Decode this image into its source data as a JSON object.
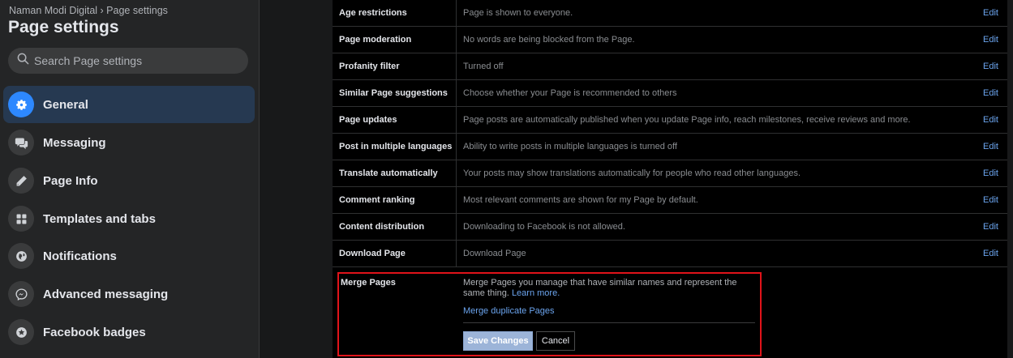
{
  "sidebar": {
    "breadcrumb": "Naman Modi Digital › Page settings",
    "title": "Page settings",
    "search_placeholder": "Search Page settings",
    "items": [
      {
        "label": "General",
        "icon": "gear-icon",
        "active": true
      },
      {
        "label": "Messaging",
        "icon": "chat-bubbles-icon"
      },
      {
        "label": "Page Info",
        "icon": "pencil-icon"
      },
      {
        "label": "Templates and tabs",
        "icon": "grid-icon"
      },
      {
        "label": "Notifications",
        "icon": "globe-icon"
      },
      {
        "label": "Advanced messaging",
        "icon": "messenger-icon"
      },
      {
        "label": "Facebook badges",
        "icon": "star-badge-icon"
      }
    ]
  },
  "settings": {
    "edit_label": "Edit",
    "rows": [
      {
        "label": "Age restrictions",
        "value": "Page is shown to everyone."
      },
      {
        "label": "Page moderation",
        "value": "No words are being blocked from the Page."
      },
      {
        "label": "Profanity filter",
        "value": "Turned off"
      },
      {
        "label": "Similar Page suggestions",
        "value": "Choose whether your Page is recommended to others"
      },
      {
        "label": "Page updates",
        "value": "Page posts are automatically published when you update Page info, reach milestones, receive reviews and more."
      },
      {
        "label": "Post in multiple languages",
        "value": "Ability to write posts in multiple languages is turned off"
      },
      {
        "label": "Translate automatically",
        "value": "Your posts may show translations automatically for people who read other languages."
      },
      {
        "label": "Comment ranking",
        "value": "Most relevant comments are shown for my Page by default."
      },
      {
        "label": "Content distribution",
        "value": "Downloading to Facebook is not allowed."
      },
      {
        "label": "Download Page",
        "value": "Download Page"
      }
    ],
    "merge": {
      "label": "Merge Pages",
      "description": "Merge Pages you manage that have similar names and represent the same thing.",
      "learn_more": "Learn more.",
      "link": "Merge duplicate Pages",
      "save": "Save Changes",
      "cancel": "Cancel"
    }
  },
  "colors": {
    "accent": "#2d88ff",
    "link": "#6ba4ee",
    "highlight_border": "#e0131a"
  }
}
